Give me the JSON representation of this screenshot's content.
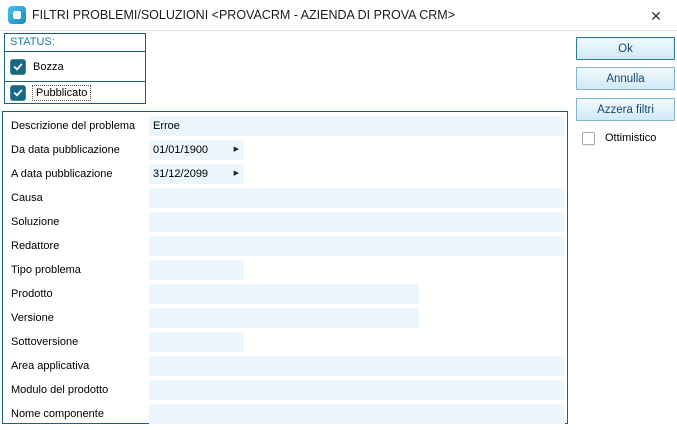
{
  "window": {
    "title": "FILTRI PROBLEMI/SOLUZIONI <PROVACRM - AZIENDA DI PROVA CRM>"
  },
  "icons": {
    "close": "✕",
    "date_arrow": "▶",
    "app_icon": "blue-rounded-square-logo"
  },
  "status_group": {
    "label": "STATUS:",
    "options": [
      {
        "label": "Bozza",
        "checked": true,
        "focused": false
      },
      {
        "label": "Pubblicato",
        "checked": true,
        "focused": true
      }
    ]
  },
  "form": {
    "rows": [
      {
        "label": "Descrizione del problema",
        "value": "Erroe",
        "size": "full",
        "type": "text"
      },
      {
        "label": "Da data pubblicazione",
        "value": "01/01/1900",
        "size": "short",
        "type": "date"
      },
      {
        "label": "A data pubblicazione",
        "value": "31/12/2099",
        "size": "short",
        "type": "date"
      },
      {
        "label": "Causa",
        "value": "",
        "size": "full",
        "type": "text"
      },
      {
        "label": "Soluzione",
        "value": "",
        "size": "full",
        "type": "text"
      },
      {
        "label": "Redattore",
        "value": "",
        "size": "full",
        "type": "text"
      },
      {
        "label": "Tipo problema",
        "value": "",
        "size": "short",
        "type": "text"
      },
      {
        "label": "Prodotto",
        "value": "",
        "size": "medium",
        "type": "text"
      },
      {
        "label": "Versione",
        "value": "",
        "size": "medium",
        "type": "text"
      },
      {
        "label": "Sottoversione",
        "value": "",
        "size": "short",
        "type": "text"
      },
      {
        "label": "Area applicativa",
        "value": "",
        "size": "full",
        "type": "text"
      },
      {
        "label": "Modulo del prodotto",
        "value": "",
        "size": "full",
        "type": "text"
      },
      {
        "label": "Nome componente",
        "value": "",
        "size": "full",
        "type": "text"
      }
    ]
  },
  "actions": {
    "ok_label": "Ok",
    "annulla_label": "Annulla",
    "azzera_label": "Azzera filtri",
    "ottimistico": {
      "label": "Ottimistico",
      "checked": false
    }
  },
  "colors": {
    "teal_border": "#19617c",
    "status_label": "#187aa5",
    "checkbox_fill": "#176884",
    "field_bg": "#ecf6fd",
    "button_text": "#17456e",
    "button_border": "#7fb4d2",
    "app_icon_blue": "#2aa5dd"
  }
}
